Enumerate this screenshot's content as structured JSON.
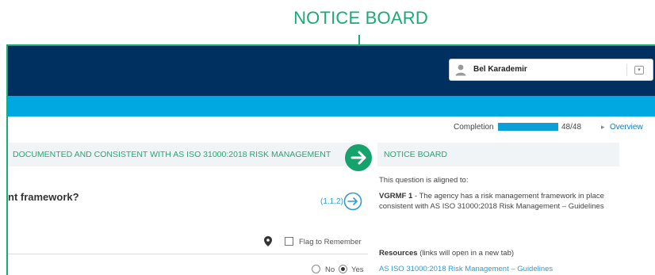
{
  "annotation": {
    "title": "NOTICE BOARD",
    "color": "#1aaa73"
  },
  "header": {
    "user_name": "Bel Karademir",
    "user_icon": "user-icon",
    "dropdown_icon": "dropdown-icon",
    "color": "#00305f",
    "subbar_color": "#00a8e1"
  },
  "progress": {
    "label": "Completion",
    "count": "48/48",
    "fraction": 1.0,
    "overview_arrow": "▸",
    "overview_label": "Overview"
  },
  "section": {
    "left_heading": "DOCUMENTED AND CONSISTENT WITH AS ISO 31000:2018 RISK MANAGEMENT",
    "right_heading": "NOTICE BOARD",
    "nav_icon": "arrow-right-icon"
  },
  "question": {
    "text": "nt framework?",
    "reference": "(1.1.2)",
    "flag_label": "Flag to Remember",
    "flag_checked": false,
    "options": [
      {
        "label": "No",
        "selected": false
      },
      {
        "label": "Yes",
        "selected": true
      }
    ]
  },
  "notice": {
    "aligned_text": "This question is aligned to:",
    "vgrmf_code": "VGRMF 1",
    "vgrmf_text": " - The agency has a risk management framework in place consistent with AS ISO 31000:2018 Risk Management – Guidelines",
    "resources_heading": "Resources",
    "resources_note": " (links will open in a new tab)",
    "resource_link": "AS ISO 31000:2018 Risk Management – Guidelines"
  }
}
